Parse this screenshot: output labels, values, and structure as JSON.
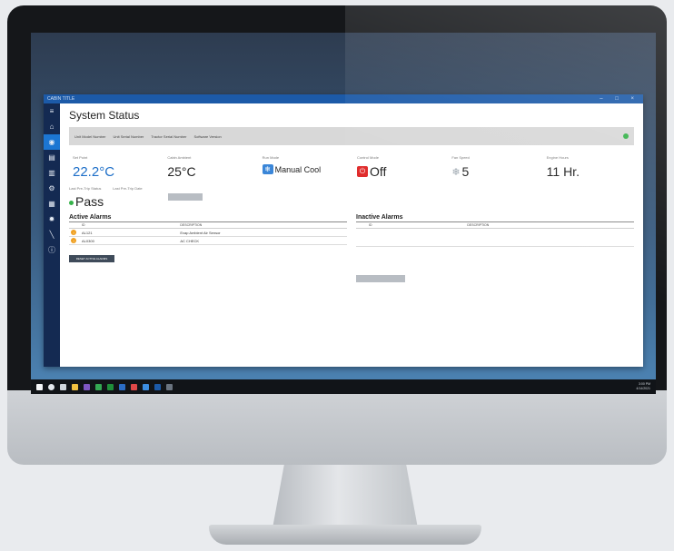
{
  "window": {
    "title": "CABIN TITLE",
    "controls": "– □ ×"
  },
  "sidebar": {
    "items": [
      {
        "icon": "hamburger-icon",
        "glyph": "≡"
      },
      {
        "icon": "home-icon",
        "glyph": "⌂"
      },
      {
        "icon": "status-icon",
        "glyph": "◉",
        "active": true
      },
      {
        "icon": "monitor-icon",
        "glyph": "▤"
      },
      {
        "icon": "card-icon",
        "glyph": "▥"
      },
      {
        "icon": "settings-icon",
        "glyph": "⚙"
      },
      {
        "icon": "folder-icon",
        "glyph": "▦"
      },
      {
        "icon": "gear-icon",
        "glyph": "✹"
      },
      {
        "icon": "wrench-icon",
        "glyph": "╲"
      },
      {
        "icon": "info-icon",
        "glyph": "ⓘ"
      }
    ]
  },
  "page": {
    "title": "System Status"
  },
  "infobar": {
    "fields": [
      "Unit Model Number",
      "Unit Serial Number",
      "Tractor Serial Number",
      "Software Version"
    ],
    "status_color": "#36b34a"
  },
  "tiles": {
    "set_point": {
      "label": "Set Point",
      "value": "22.2°C"
    },
    "cabin_ambient": {
      "label": "Cabin Ambient",
      "value": "25°C"
    },
    "run_mode": {
      "label": "Run Mode",
      "value": "Manual Cool"
    },
    "control_mode": {
      "label": "Control Mode",
      "value": "Off"
    },
    "fan_speed": {
      "label": "Fan Speed",
      "value": "5"
    },
    "engine_hours": {
      "label": "Engine Hours",
      "value": "11 Hr."
    }
  },
  "pretrip": {
    "status_label": "Last Pre-Trip Status",
    "date_label": "Last Pre-Trip Date",
    "status_value": "Pass"
  },
  "active_alarms": {
    "title": "Active Alarms",
    "columns": [
      "ID",
      "DESCRIPTION"
    ],
    "rows": [
      {
        "id": "AL121",
        "description": "Evap Ambient Air Sensor"
      },
      {
        "id": "AL0300",
        "description": "AC CHECK"
      }
    ],
    "reset_label": "RESET ACTIVE ALARMS"
  },
  "inactive_alarms": {
    "title": "Inactive Alarms",
    "columns": [
      "ID",
      "DESCRIPTION"
    ]
  },
  "taskbar": {
    "time": "3:00 PM",
    "date": "4/14/2021"
  }
}
